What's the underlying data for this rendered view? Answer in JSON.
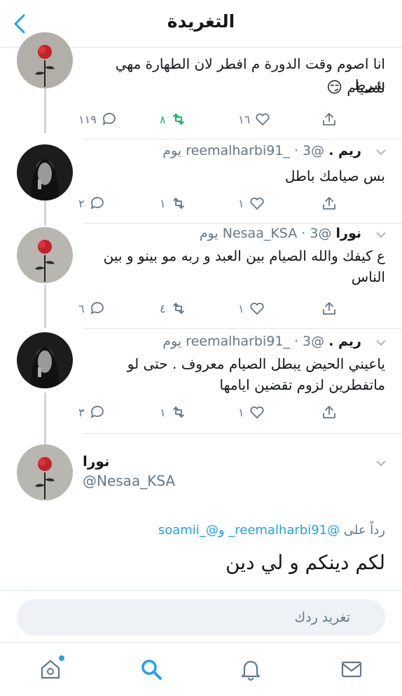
{
  "header": {
    "title": "التغريدة"
  },
  "tweets": [
    {
      "text_line1": "انا اصوم وقت الدورة م افطر لان الطهارة مهي شرط",
      "text_line2": "للصيام",
      "emoji": "😏",
      "replies": "١١٩",
      "retweets": "٨",
      "likes": "١٦"
    },
    {
      "name": "ريم .",
      "handle": "@reemalharbi91_",
      "time": "3 يوم",
      "text": "بس صيامك باطل",
      "replies": "٢",
      "retweets": "١",
      "likes": "١"
    },
    {
      "name": "نورا",
      "handle": "@Nesaa_KSA",
      "time": "3 يوم",
      "text": "ع كيفك والله الصيام بين العبد و ربه مو بينو و بين الناس",
      "replies": "٦",
      "retweets": "٤",
      "likes": "١"
    },
    {
      "name": "ريم .",
      "handle": "@reemalharbi91_",
      "time": "3 يوم",
      "text": "ياعيني الحيض يبطل الصيام معروف . حتى لو ماتفطرين لزوم تقضين ايامها",
      "replies": "٣",
      "retweets": "١",
      "likes": "١"
    }
  ],
  "main_tweet": {
    "name": "نورا",
    "handle": "@Nesaa_KSA",
    "replying_prefix": "رداً على",
    "replying_to": "@reemalharbi91_ و@_soamii",
    "text": "لكم دينكم و لي دين"
  },
  "reply_bar": {
    "placeholder": "تغريد ردك"
  },
  "tabs": [
    "home",
    "search",
    "notifications",
    "messages"
  ],
  "colors": {
    "accent": "#1da1f2",
    "retweet_active": "#17bf63",
    "muted": "#657786"
  }
}
